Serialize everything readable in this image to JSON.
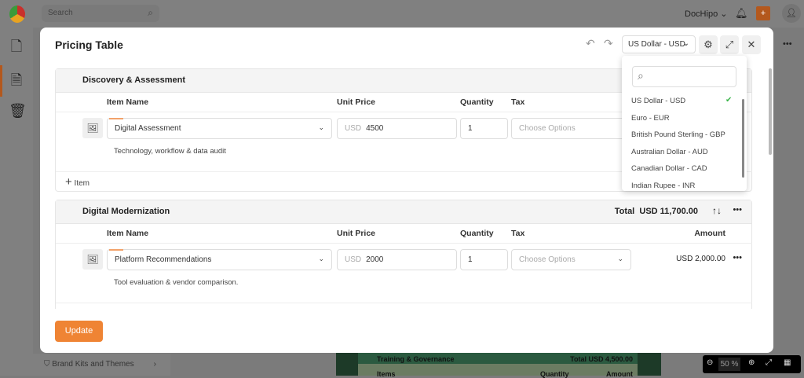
{
  "app": {
    "search_placeholder": "Search",
    "workspace": "DocHipo",
    "brand_kits": "Brand Kits and Themes",
    "zoom": "50",
    "zoom_unit": "%"
  },
  "canvas": {
    "section": "Training & Governance",
    "total": "Total  USD 4,500.00",
    "col_items": "Items",
    "col_quantity": "Quantity",
    "col_amount": "Amount"
  },
  "modal": {
    "title": "Pricing Table",
    "currency": "US Dollar - USD",
    "update_label": "Update",
    "currency_options": [
      {
        "label": "US Dollar - USD",
        "selected": true
      },
      {
        "label": "Euro - EUR"
      },
      {
        "label": "British Pound Sterling - GBP"
      },
      {
        "label": "Australian Dollar - AUD"
      },
      {
        "label": "Canadian Dollar - CAD"
      },
      {
        "label": "Indian Rupee - INR"
      }
    ],
    "columns": {
      "item_name": "Item Name",
      "unit_price": "Unit Price",
      "quantity": "Quantity",
      "tax": "Tax",
      "amount": "Amount"
    },
    "sections": [
      {
        "title": "Discovery & Assessment",
        "items": [
          {
            "name": "Digital Assessment",
            "currency": "USD",
            "price": "4500",
            "quantity": "1",
            "tax_placeholder": "Choose Options",
            "description": "Technology, workflow & data audit"
          }
        ],
        "add_item": "Item"
      },
      {
        "title": "Digital Modernization",
        "total_label": "Total",
        "total": "USD 11,700.00",
        "items": [
          {
            "name": "Platform Recommendations",
            "currency": "USD",
            "price": "2000",
            "quantity": "1",
            "tax_placeholder": "Choose Options",
            "amount": "USD 2,000.00",
            "description": "Tool evaluation & vendor comparison."
          }
        ]
      }
    ]
  },
  "colors": {
    "accent": "#ef8434",
    "check": "#3bb54a"
  }
}
